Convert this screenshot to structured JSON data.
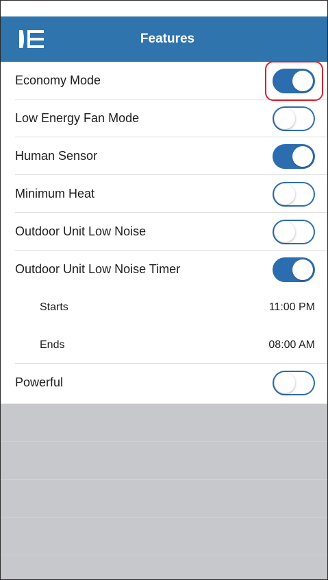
{
  "header": {
    "title": "Features",
    "menu_icon": "sidebar-menu-icon"
  },
  "features": {
    "economy_mode": {
      "label": "Economy Mode",
      "enabled": true
    },
    "low_energy_fan_mode": {
      "label": "Low Energy Fan Mode",
      "enabled": false
    },
    "human_sensor": {
      "label": "Human Sensor",
      "enabled": true
    },
    "minimum_heat": {
      "label": "Minimum Heat",
      "enabled": false
    },
    "outdoor_unit_low_noise": {
      "label": "Outdoor Unit Low Noise",
      "enabled": false
    },
    "outdoor_unit_low_noise_timer": {
      "label": "Outdoor Unit Low Noise Timer",
      "enabled": true
    },
    "timer_starts": {
      "label": "Starts",
      "value": "11:00 PM"
    },
    "timer_ends": {
      "label": "Ends",
      "value": "08:00 AM"
    },
    "powerful": {
      "label": "Powerful",
      "enabled": false
    }
  },
  "colors": {
    "header_background": "#2f74ad",
    "toggle_on": "#2c6db0",
    "highlight": "#d8222a",
    "empty_background": "#c7c8cb"
  }
}
